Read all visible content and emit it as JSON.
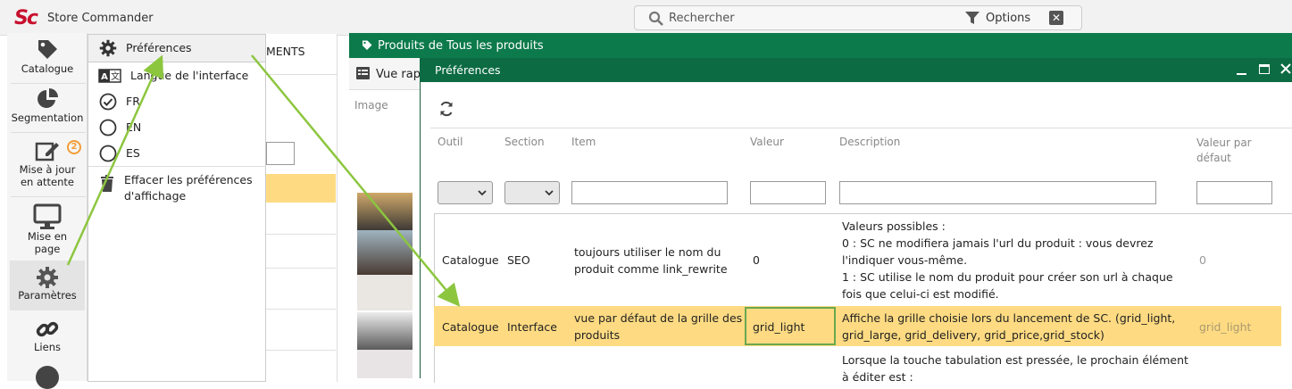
{
  "app": {
    "logo": "Sc",
    "title": "Store Commander"
  },
  "search": {
    "label": "Rechercher",
    "options_label": "Options",
    "close_glyph": "✕"
  },
  "sidebar": {
    "items": [
      {
        "label": "Catalogue",
        "icon": "tag-icon"
      },
      {
        "label": "Segmentation",
        "icon": "pie-chart-icon"
      },
      {
        "label_line1": "Mise à jour",
        "label_line2": "en attente",
        "icon": "edit-icon",
        "badge": "2"
      },
      {
        "label_line1": "Mise en",
        "label_line2": "page",
        "icon": "monitor-icon"
      },
      {
        "label": "Paramètres",
        "icon": "gear-icon"
      },
      {
        "label": "Liens",
        "icon": "link-icon"
      }
    ]
  },
  "menu": {
    "preferences": "Préférences",
    "language": "Langue de l'interface",
    "languages": [
      "FR",
      "EN",
      "ES"
    ],
    "clear_line1": "Effacer les préférences",
    "clear_line2": "d'affichage"
  },
  "left_panel": {
    "tab_partial": "MENTS"
  },
  "main": {
    "header_title": "Produits de Tous les produits",
    "view_label": "Vue rap",
    "image_col": "Image"
  },
  "dialog": {
    "title": "Préférences",
    "columns": [
      "Outil",
      "Section",
      "Item",
      "Valeur",
      "Description",
      "Valeur par défaut"
    ],
    "rows": [
      {
        "outil": "Catalogue",
        "section": "SEO",
        "item_line1": "toujours utiliser le nom du",
        "item_line2": "produit comme link_rewrite",
        "valeur": "0",
        "desc_lines": [
          "Valeurs possibles :",
          "0 : SC ne modifiera jamais l'url du produit : vous devrez",
          "l'indiquer vous-même.",
          "1 : SC utilise le nom du produit pour créer son url à chaque",
          "fois que celui-ci est modifié."
        ],
        "defaut": "0"
      },
      {
        "outil": "Catalogue",
        "section": "Interface",
        "item_line1": "vue par défaut de la grille des",
        "item_line2": "produits",
        "valeur": "grid_light",
        "desc_lines": [
          "Affiche la grille choisie lors du lancement de SC. (grid_light,",
          "grid_large, grid_delivery, grid_price,grid_stock)"
        ],
        "defaut": "grid_light"
      },
      {
        "desc_lines": [
          "Lorsque la touche tabulation est pressée, le prochain élément",
          "à éditer est :"
        ]
      }
    ]
  },
  "colors": {
    "brand": "#c8102e",
    "header_green": "#0c7a4b",
    "highlight": "#fedb82",
    "arrow": "#8cc63f"
  }
}
